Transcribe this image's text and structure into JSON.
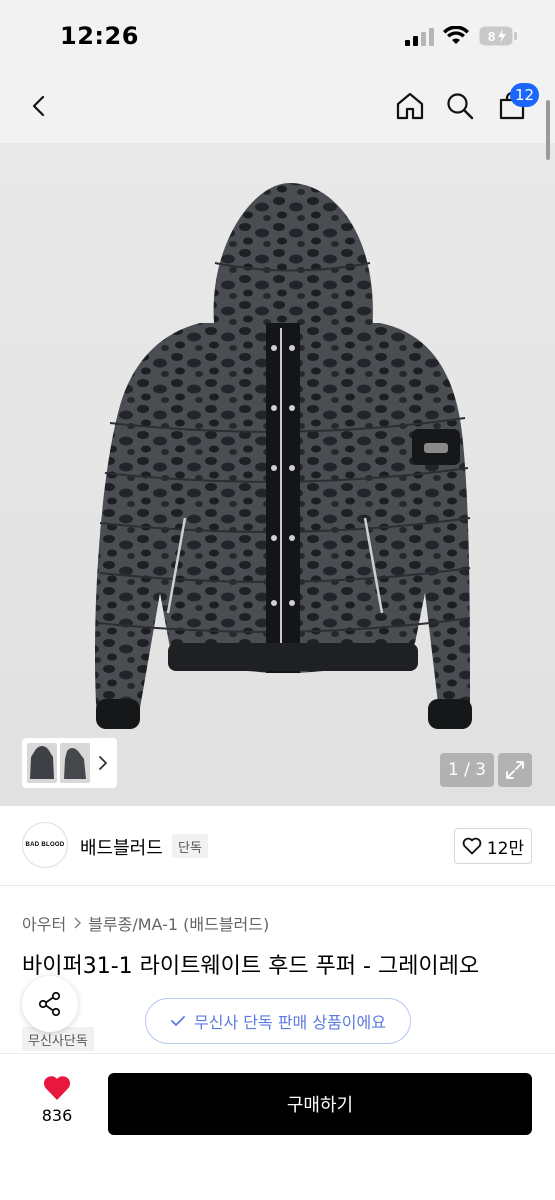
{
  "status_bar": {
    "time": "12:26",
    "battery": "8"
  },
  "nav": {
    "cart_count": "12"
  },
  "gallery": {
    "page_counter": "1 / 3"
  },
  "brand": {
    "logo_text": "BAD BLOOD",
    "name": "배드블러드",
    "tag": "단독",
    "likes": "12만"
  },
  "product": {
    "breadcrumb": [
      "아우터",
      "블루종/MA-1 (배드블러드)"
    ],
    "title": "바이퍼31-1 라이트웨이트 후드 푸퍼 - 그레이레오",
    "exclusive_tag": "무신사단독"
  },
  "toast": {
    "text": "무신사 단독 판매 상품이에요"
  },
  "bottom": {
    "wish_count": "836",
    "buy_label": "구매하기"
  },
  "icons": {
    "back": "chevron-left-icon",
    "home": "home-icon",
    "search": "search-icon",
    "cart": "shopping-bag-icon",
    "expand": "expand-icon",
    "heart": "heart-icon",
    "share": "share-icon",
    "check": "check-icon"
  },
  "colors": {
    "accent": "#1a66ff",
    "wish_red": "#e8173d",
    "toast_blue": "#5b7be0"
  }
}
